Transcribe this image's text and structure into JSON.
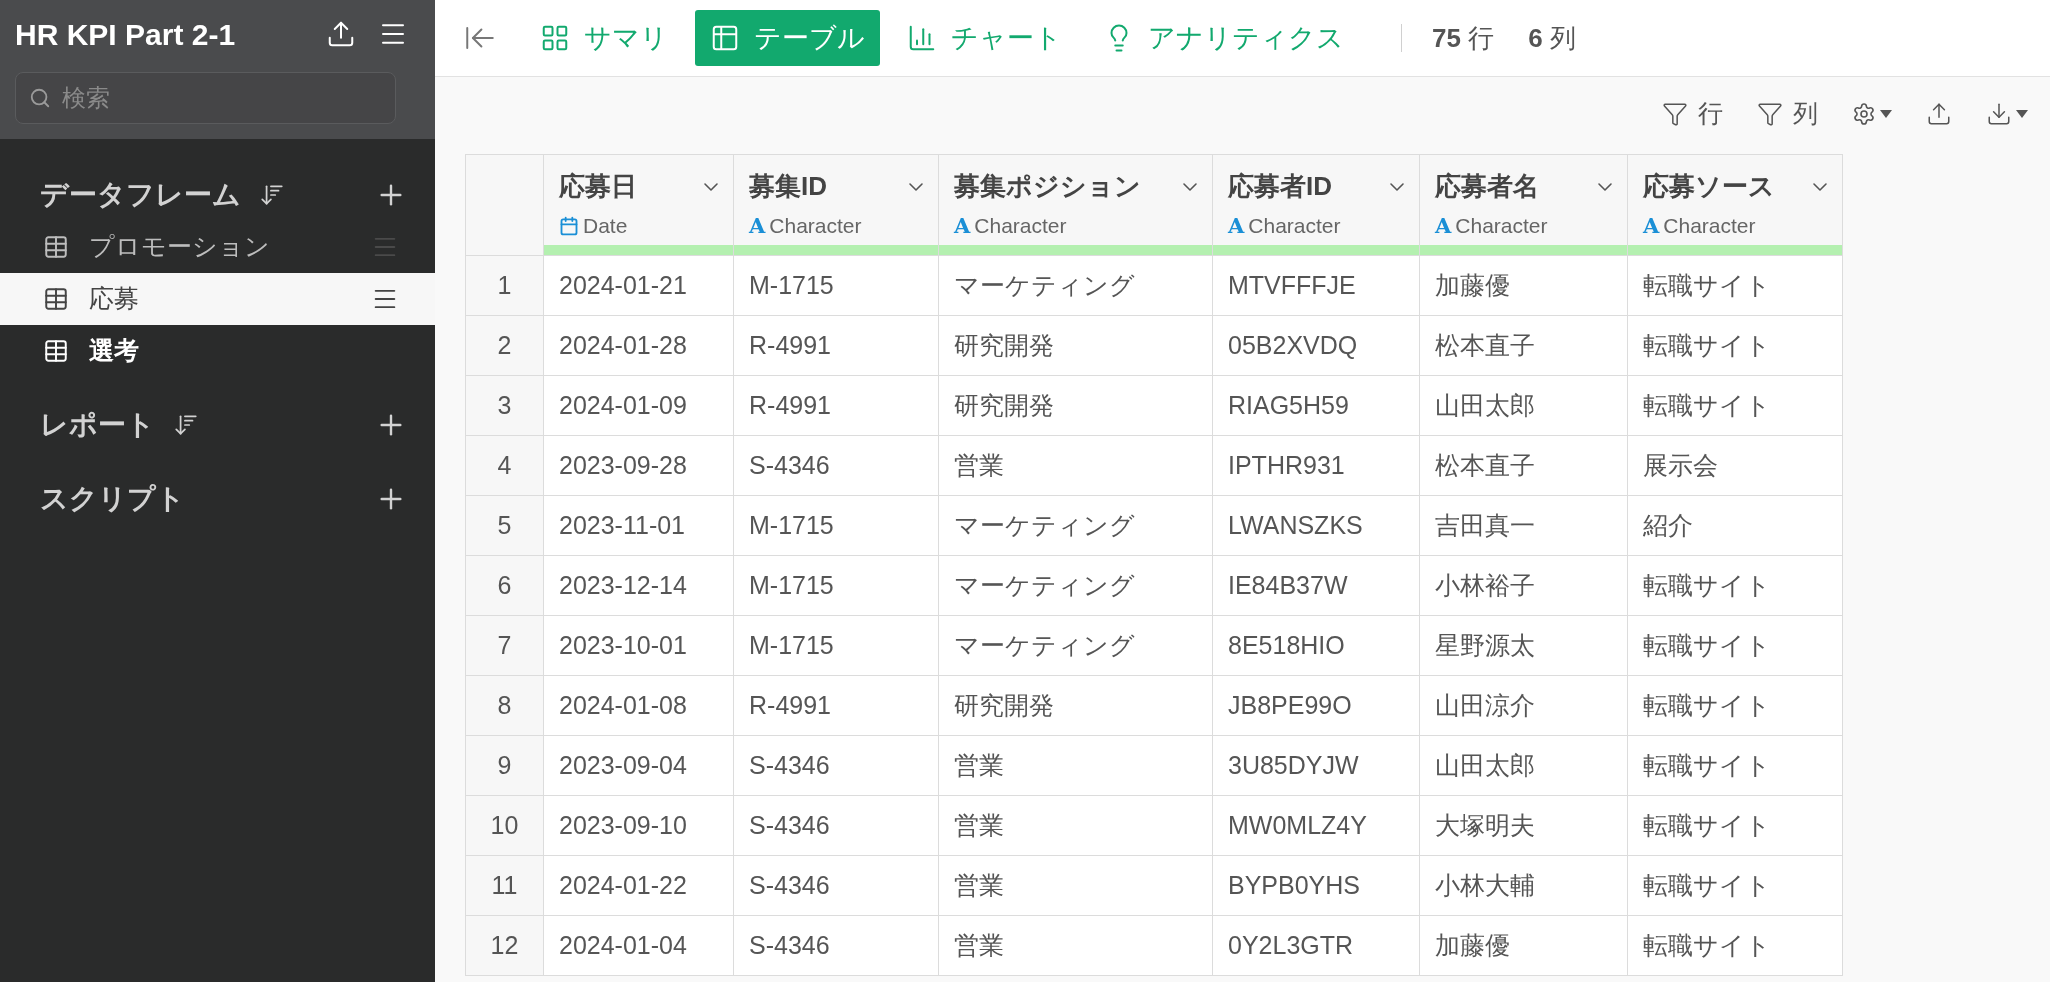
{
  "sidebar": {
    "title": "HR KPI Part 2-1",
    "search": {
      "placeholder": "検索"
    },
    "sections": [
      {
        "label": "データフレーム",
        "sortable": true,
        "items": [
          {
            "label": "プロモーション",
            "selected": false,
            "bold": false,
            "show_menu": true
          },
          {
            "label": "応募",
            "selected": true,
            "bold": false,
            "show_menu": true
          },
          {
            "label": "選考",
            "selected": false,
            "bold": true,
            "show_menu": false
          }
        ]
      },
      {
        "label": "レポート",
        "sortable": true
      },
      {
        "label": "スクリプト",
        "sortable": false
      }
    ]
  },
  "toolbar": {
    "tabs": [
      {
        "label": "サマリ",
        "kind": "summary",
        "selected": false
      },
      {
        "label": "テーブル",
        "kind": "table",
        "selected": true
      },
      {
        "label": "チャート",
        "kind": "chart",
        "selected": false
      },
      {
        "label": "アナリティクス",
        "kind": "analytics",
        "selected": false
      }
    ],
    "rows_count": "75",
    "rows_unit": "行",
    "cols_count": "6",
    "cols_unit": "列"
  },
  "actions": {
    "row_filter": "行",
    "col_filter": "列"
  },
  "table": {
    "columns": [
      {
        "name": "応募日",
        "kind": "date",
        "type": "Date"
      },
      {
        "name": "募集ID",
        "kind": "character",
        "icon_text": "A",
        "type": "Character"
      },
      {
        "name": "募集ポジション",
        "kind": "character",
        "icon_text": "A",
        "type": "Character"
      },
      {
        "name": "応募者ID",
        "kind": "character",
        "icon_text": "A",
        "type": "Character"
      },
      {
        "name": "応募者名",
        "kind": "character",
        "icon_text": "A",
        "type": "Character"
      },
      {
        "name": "応募ソース",
        "kind": "character",
        "icon_text": "A",
        "type": "Character"
      }
    ],
    "rows": [
      {
        "n": "1",
        "cells": [
          "2024-01-21",
          "M-1715",
          "マーケティング",
          "MTVFFFJE",
          "加藤優",
          "転職サイト"
        ]
      },
      {
        "n": "2",
        "cells": [
          "2024-01-28",
          "R-4991",
          "研究開発",
          "05B2XVDQ",
          "松本直子",
          "転職サイト"
        ]
      },
      {
        "n": "3",
        "cells": [
          "2024-01-09",
          "R-4991",
          "研究開発",
          "RIAG5H59",
          "山田太郎",
          "転職サイト"
        ]
      },
      {
        "n": "4",
        "cells": [
          "2023-09-28",
          "S-4346",
          "営業",
          "IPTHR931",
          "松本直子",
          "展示会"
        ]
      },
      {
        "n": "5",
        "cells": [
          "2023-11-01",
          "M-1715",
          "マーケティング",
          "LWANSZKS",
          "吉田真一",
          "紹介"
        ]
      },
      {
        "n": "6",
        "cells": [
          "2023-12-14",
          "M-1715",
          "マーケティング",
          "IE84B37W",
          "小林裕子",
          "転職サイト"
        ]
      },
      {
        "n": "7",
        "cells": [
          "2023-10-01",
          "M-1715",
          "マーケティング",
          "8E518HIO",
          "星野源太",
          "転職サイト"
        ]
      },
      {
        "n": "8",
        "cells": [
          "2024-01-08",
          "R-4991",
          "研究開発",
          "JB8PE99O",
          "山田涼介",
          "転職サイト"
        ]
      },
      {
        "n": "9",
        "cells": [
          "2023-09-04",
          "S-4346",
          "営業",
          "3U85DYJW",
          "山田太郎",
          "転職サイト"
        ]
      },
      {
        "n": "10",
        "cells": [
          "2023-09-10",
          "S-4346",
          "営業",
          "MW0MLZ4Y",
          "大塚明夫",
          "転職サイト"
        ]
      },
      {
        "n": "11",
        "cells": [
          "2024-01-22",
          "S-4346",
          "営業",
          "BYPB0YHS",
          "小林大輔",
          "転職サイト"
        ]
      },
      {
        "n": "12",
        "cells": [
          "2024-01-04",
          "S-4346",
          "営業",
          "0Y2L3GTR",
          "加藤優",
          "転職サイト"
        ]
      }
    ]
  }
}
